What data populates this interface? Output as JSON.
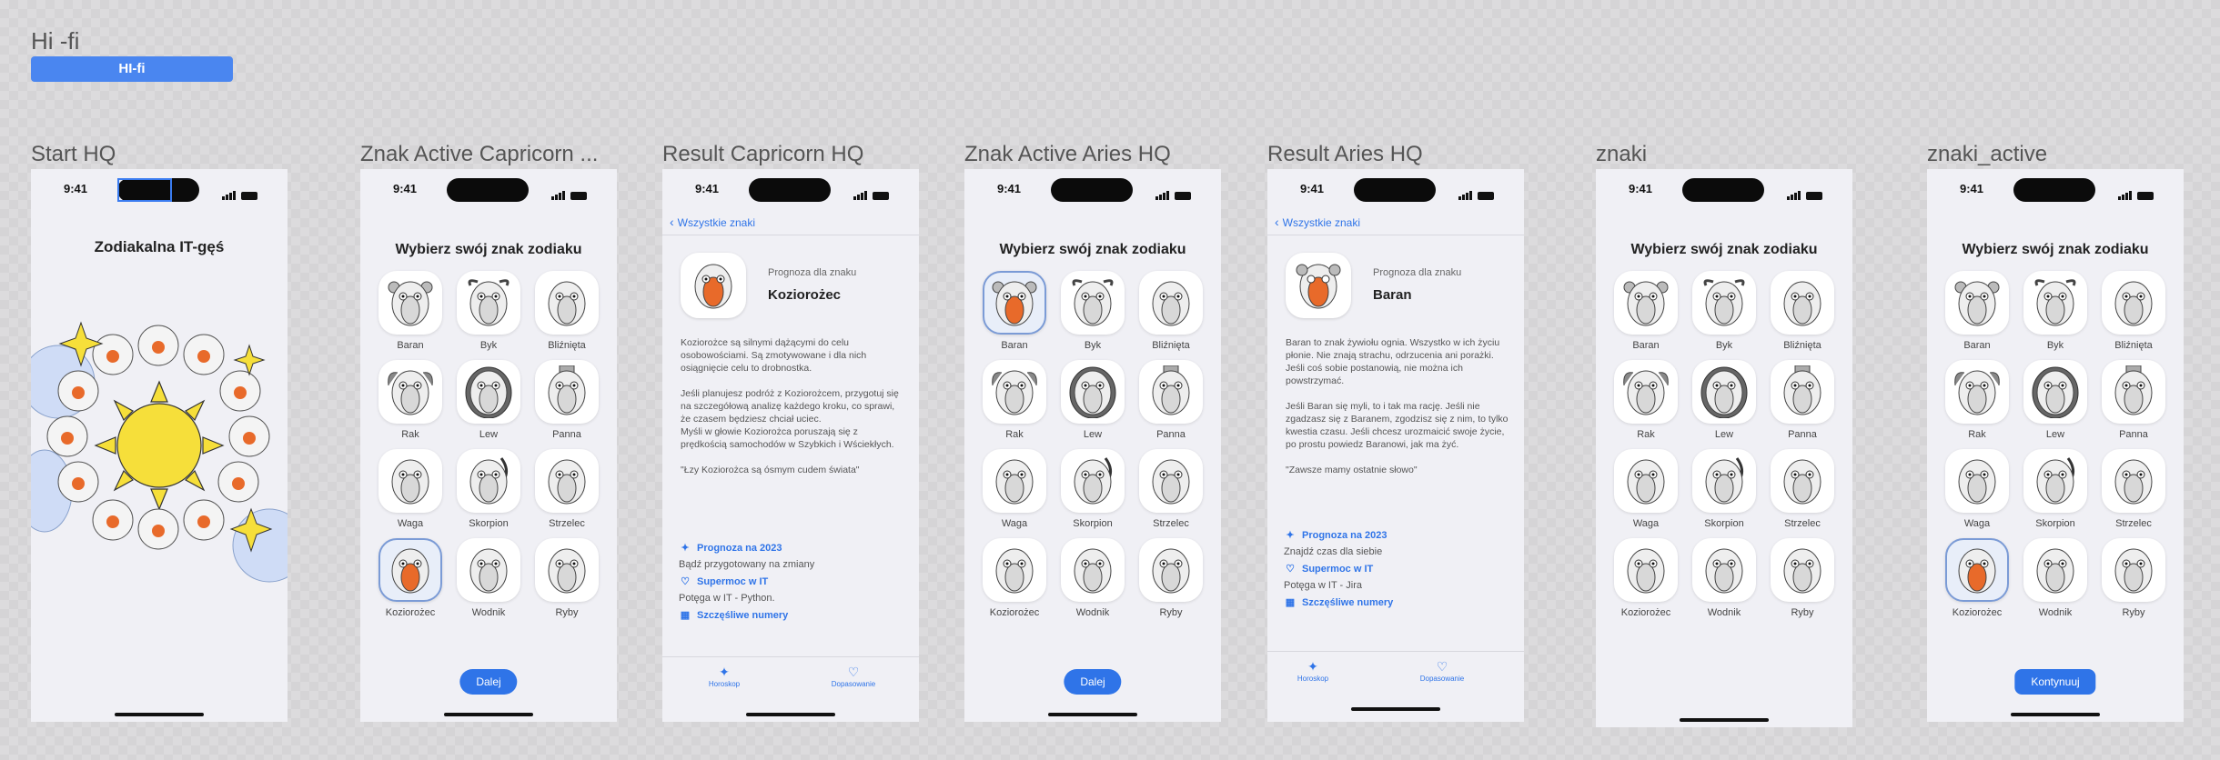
{
  "section": {
    "title": "Hi -fi",
    "button": "HI-fi"
  },
  "status_time": "9:41",
  "frames": {
    "start": {
      "label": "Start HQ",
      "title": "Zodiakalna IT-gęś"
    },
    "znak_capricorn": {
      "label": "Znak Active  Capricorn ...",
      "title": "Wybierz swój znak zodiaku",
      "button": "Dalej"
    },
    "result_capricorn": {
      "label": "Result Capricorn HQ",
      "back": "Wszystkie znaki",
      "prognosis_label": "Prognoza dla znaku",
      "sign": "Koziorożec",
      "description": "Koziorożce są silnymi dążącymi do celu osobowościami. Są zmotywowane i dla nich osiągnięcie celu to drobnostka.\n\nJeśli planujesz podróż z Koziorożcem, przygotuj się na szczegółową analizę każdego kroku, co sprawi, że czasem będziesz chciał uciec.\nMyśli w głowie Koziorożca poruszają się z prędkością samochodów w Szybkich i Wściekłych.\n\n\"Łzy Koziorożca są ósmym cudem świata\"",
      "forecast": "Prognoza na 2023",
      "forecast_sub": "Bądź przygotowany na zmiany",
      "power": "Supermoc w IT",
      "power_sub": "Potęga w IT - Python.",
      "numbers": "Szczęśliwe numery",
      "tabs": [
        "Horoskop",
        "Dopasowanie"
      ]
    },
    "znak_aries": {
      "label": "Znak Active Aries HQ",
      "title": "Wybierz swój znak zodiaku",
      "button": "Dalej"
    },
    "result_aries": {
      "label": "Result Aries HQ",
      "back": "Wszystkie znaki",
      "prognosis_label": "Prognoza dla znaku",
      "sign": "Baran",
      "description": "Baran to znak żywiołu ognia. Wszystko w ich życiu płonie. Nie znają strachu, odrzucenia ani porażki. Jeśli coś sobie postanowią, nie można ich powstrzymać.\n\nJeśli Baran się myli, to i tak ma rację. Jeśli nie zgadzasz się z Baranem, zgodzisz się z nim, to tylko kwestia czasu. Jeśli chcesz urozmaicić swoje życie, po prostu powiedz Baranowi, jak ma żyć.\n\n\"Zawsze mamy ostatnie słowo\"",
      "forecast": "Prognoza na 2023",
      "forecast_sub": "Znajdź czas dla siebie",
      "power": "Supermoc w IT",
      "power_sub": "Potęga w IT - Jira",
      "numbers": "Szczęśliwe numery",
      "tabs": [
        "Horoskop",
        "Dopasowanie"
      ]
    },
    "znaki": {
      "label": "znaki",
      "title": "Wybierz swój znak zodiaku"
    },
    "znaki_active": {
      "label": "znaki_active",
      "title": "Wybierz swój znak zodiaku",
      "button": "Kontynuuj"
    }
  },
  "signs": [
    "Baran",
    "Byk",
    "Bliźnięta",
    "Rak",
    "Lew",
    "Panna",
    "Waga",
    "Skorpion",
    "Strzelec",
    "Koziorożec",
    "Wodnik",
    "Ryby"
  ],
  "colors": {
    "accent": "#2f74e8",
    "section_button": "#4a86f0",
    "phone_bg": "#f0f0f5"
  }
}
